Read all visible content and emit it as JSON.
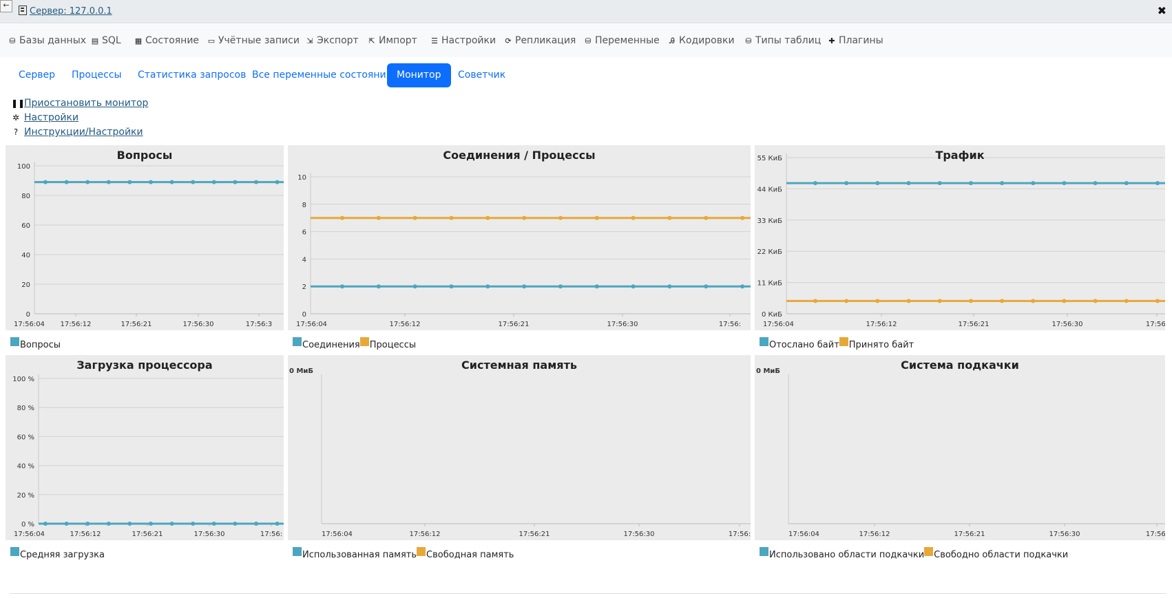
{
  "header": {
    "back_label": "←",
    "server_label": "Сервер: 127.0.0.1",
    "close_label": "✖"
  },
  "menu": {
    "items": [
      {
        "label": "Базы данных",
        "icon": "database-icon"
      },
      {
        "label": "SQL",
        "icon": "sql-icon"
      },
      {
        "label": "Состояние",
        "icon": "status-icon"
      },
      {
        "label": "Учётные записи",
        "icon": "users-icon"
      },
      {
        "label": "Экспорт",
        "icon": "export-icon"
      },
      {
        "label": "Импорт",
        "icon": "import-icon"
      },
      {
        "label": "Настройки",
        "icon": "settings-icon"
      },
      {
        "label": "Репликация",
        "icon": "replication-icon"
      },
      {
        "label": "Переменные",
        "icon": "variables-icon"
      },
      {
        "label": "Кодировки",
        "icon": "charsets-icon"
      },
      {
        "label": "Типы таблиц",
        "icon": "engines-icon"
      },
      {
        "label": "Плагины",
        "icon": "plugins-icon"
      }
    ]
  },
  "tabs": {
    "items": [
      {
        "label": "Сервер"
      },
      {
        "label": "Процессы"
      },
      {
        "label": "Статистика запросов"
      },
      {
        "label": "Все переменные состояния"
      },
      {
        "label": "Монитор"
      },
      {
        "label": "Советчик"
      }
    ],
    "active": "Монитор"
  },
  "actions": {
    "pause": "Приостановить монитор",
    "settings": "Настройки",
    "instructions": "Инструкции/Настройки"
  },
  "colors": {
    "series1": "#4ca6bf",
    "series2": "#e8a838",
    "panel_bg": "#ebebeb",
    "active_tab": "#0d6efd"
  },
  "chart_data": [
    {
      "type": "line",
      "title": "Вопросы",
      "x": [
        "17:56:04",
        "17:56:12",
        "17:56:21",
        "17:56:30",
        "17:56:3"
      ],
      "yticks": [
        "0",
        "20",
        "40",
        "60",
        "80",
        "100"
      ],
      "ylim": [
        0,
        100
      ],
      "series": [
        {
          "name": "Вопросы",
          "values": [
            89,
            89,
            89,
            89,
            89,
            89,
            89,
            89,
            89,
            89,
            89,
            89
          ]
        }
      ]
    },
    {
      "type": "line",
      "title": "Соединения / Процессы",
      "x": [
        "17:56:04",
        "17:56:12",
        "17:56:21",
        "17:56:30",
        "17:56:"
      ],
      "yticks": [
        "0",
        "2",
        "4",
        "6",
        "8",
        "10"
      ],
      "ylim": [
        0,
        10
      ],
      "series": [
        {
          "name": "Соединения",
          "values": [
            2,
            2,
            2,
            2,
            2,
            2,
            2,
            2,
            2,
            2,
            2,
            2
          ]
        },
        {
          "name": "Процессы",
          "values": [
            7,
            7,
            7,
            7,
            7,
            7,
            7,
            7,
            7,
            7,
            7,
            7
          ]
        }
      ]
    },
    {
      "type": "line",
      "title": "Трафик",
      "x": [
        "17:56:04",
        "17:56:12",
        "17:56:21",
        "17:56:30",
        "17:56:"
      ],
      "yticks": [
        "0 КиБ",
        "11 КиБ",
        "22 КиБ",
        "33 КиБ",
        "44 КиБ",
        "55 КиБ"
      ],
      "ylim": [
        0,
        55
      ],
      "series": [
        {
          "name": "Отослано байт",
          "values": [
            46,
            46,
            46,
            46,
            46,
            46,
            46,
            46,
            46,
            46,
            46,
            46
          ]
        },
        {
          "name": "Принято байт",
          "values": [
            4.5,
            4.5,
            4.5,
            4.5,
            4.5,
            4.5,
            4.5,
            4.5,
            4.5,
            4.5,
            4.5,
            4.5
          ]
        }
      ]
    },
    {
      "type": "line",
      "title": "Загрузка процессора",
      "x": [
        "17:56:04",
        "17:56:12",
        "17:56:21",
        "17:56:30",
        "17:56:"
      ],
      "yticks": [
        "0 %",
        "20 %",
        "40 %",
        "60 %",
        "80 %",
        "100 %"
      ],
      "ylim": [
        0,
        100
      ],
      "series": [
        {
          "name": "Средняя загрузка",
          "values": [
            0,
            0,
            0,
            0,
            0,
            0,
            0,
            0,
            0,
            0,
            0,
            0
          ]
        }
      ]
    },
    {
      "type": "line",
      "title": "Системная память",
      "x": [
        "17:56:04",
        "17:56:12",
        "17:56:21",
        "17:56:30",
        "17:56:"
      ],
      "yticks": [
        "0 МиБ"
      ],
      "series": [
        {
          "name": "Использованная память",
          "values": []
        },
        {
          "name": "Свободная память",
          "values": []
        }
      ]
    },
    {
      "type": "line",
      "title": "Система подкачки",
      "x": [
        "17:56:04",
        "17:56:12",
        "17:56:21",
        "17:56:30",
        "17:56:"
      ],
      "yticks": [
        "0 МиБ"
      ],
      "series": [
        {
          "name": "Использовано области подкачки",
          "values": []
        },
        {
          "name": "Свободно области подкачки",
          "values": []
        }
      ]
    }
  ]
}
